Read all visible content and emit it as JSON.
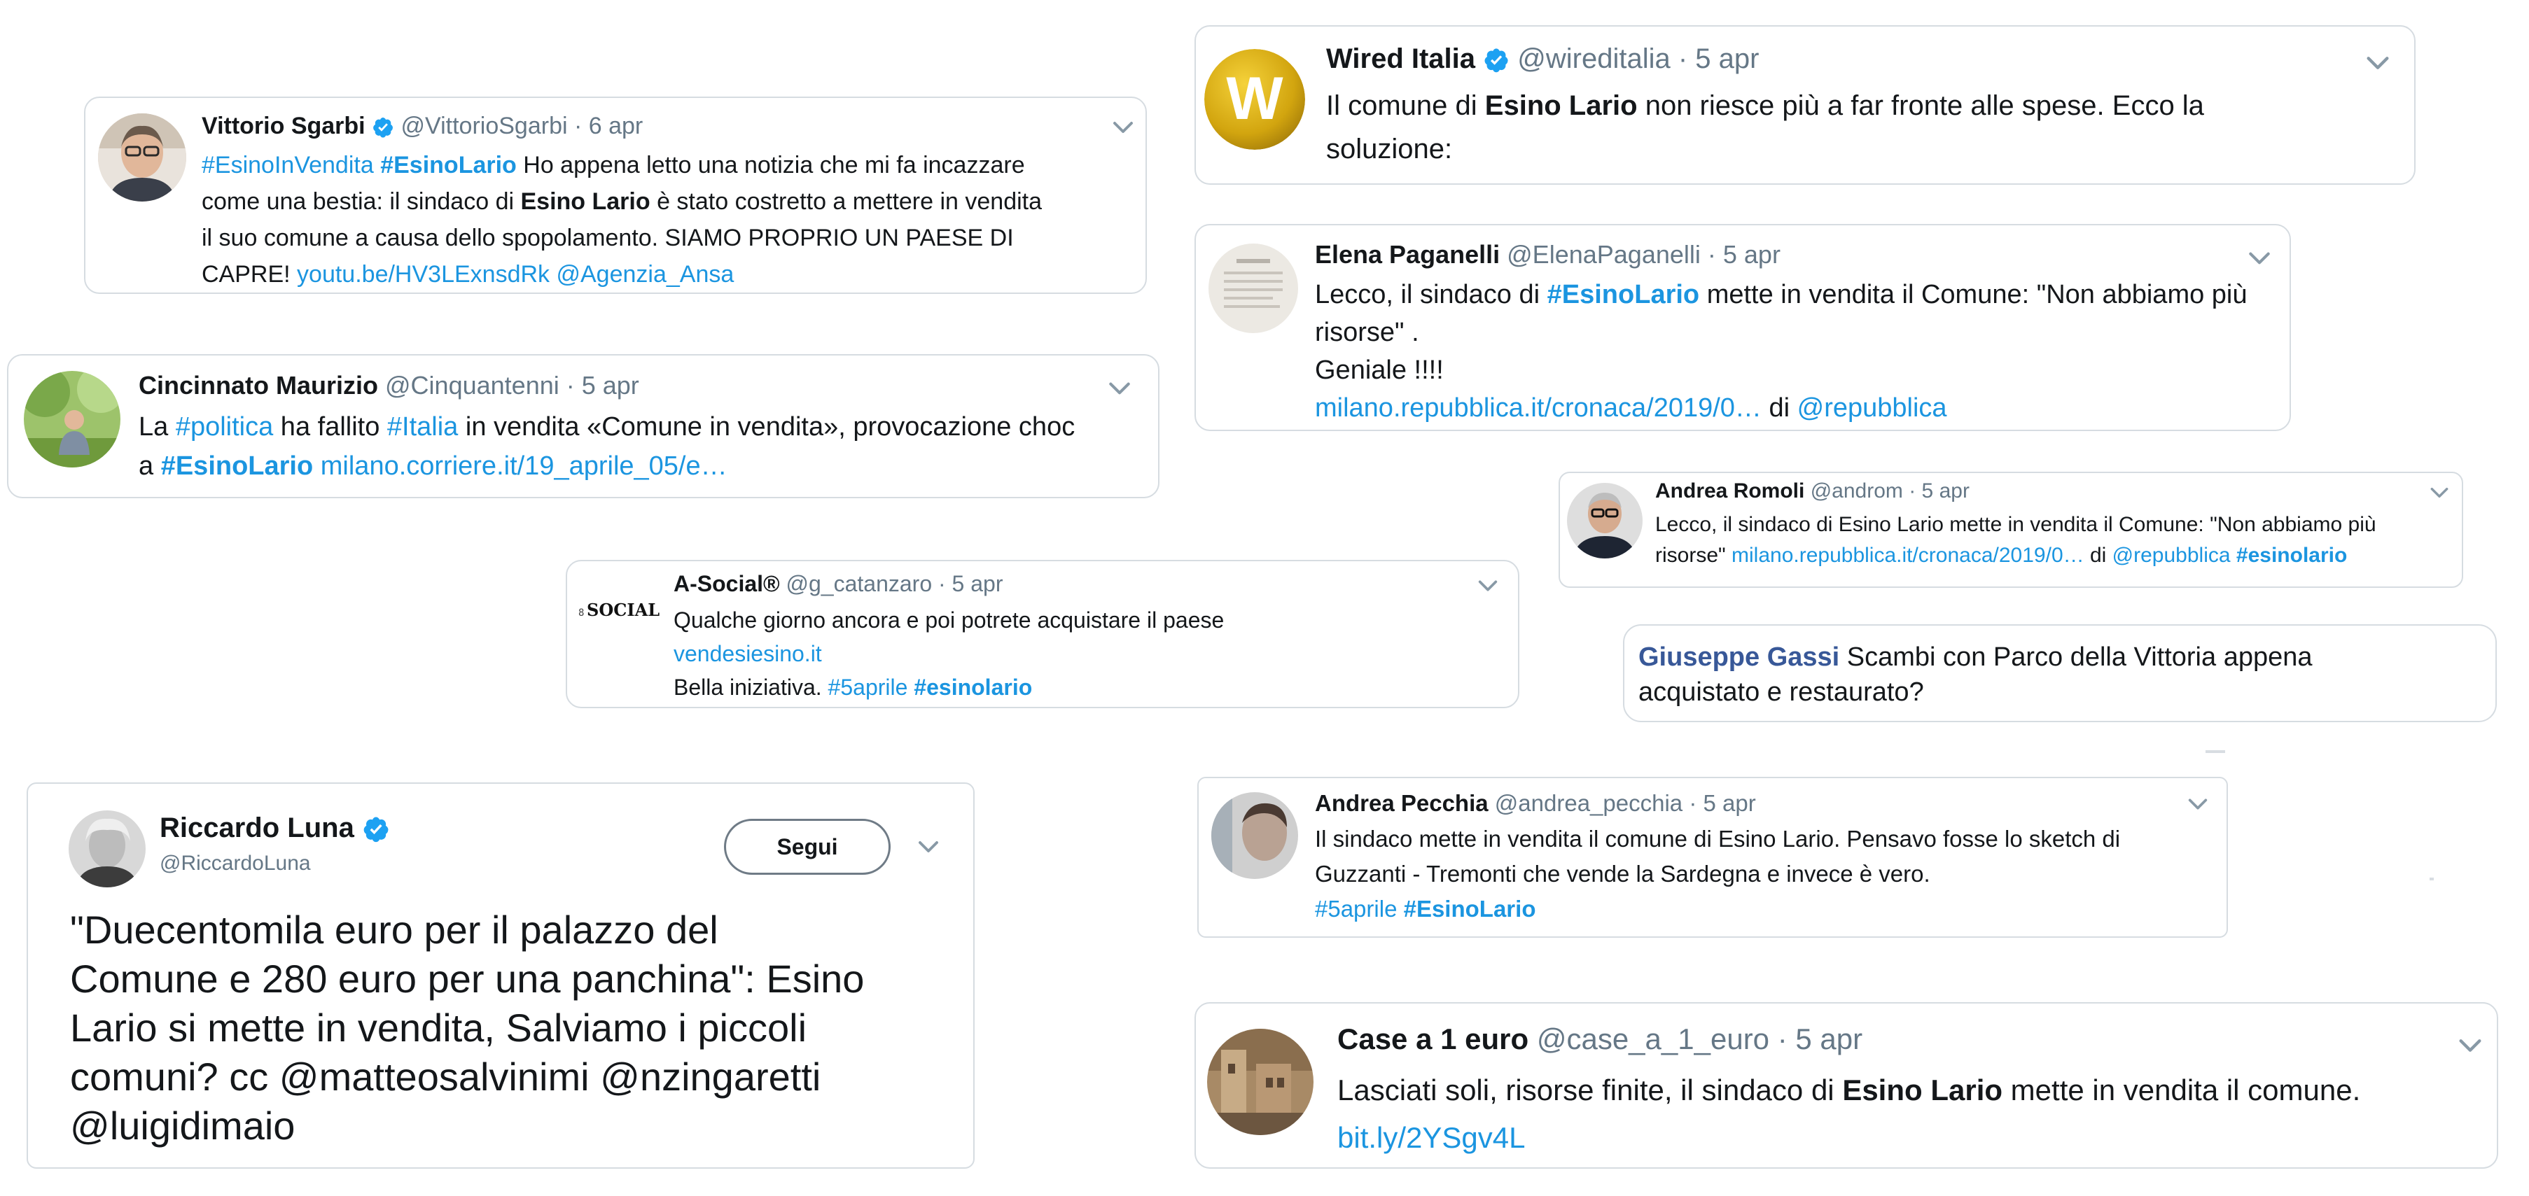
{
  "colors": {
    "link": "#1b95e0",
    "text": "#14171a",
    "muted": "#657786",
    "border": "#d6dce1"
  },
  "tweets": {
    "sgarbi": {
      "name": "Vittorio Sgarbi",
      "handle": "@VittorioSgarbi",
      "date": "· 6 apr",
      "l1_t1": "#EsinoInVendita",
      "l1_t2": "#EsinoLario",
      "l1_s": " Ho appena letto una notizia che mi fa incazzare",
      "l2_s1": "come una bestia: il sindaco di ",
      "l2_b": "Esino Lario",
      "l2_s2": " è stato costretto a mettere in  vendita",
      "l3": "il suo comune a causa dello spopolamento. SIAMO PROPRIO UN PAESE DI",
      "l4_s": "CAPRE! ",
      "l4_link": "youtu.be/HV3LExnsdRk",
      "l4_mention": "@Agenzia_Ansa",
      "avatar_icon": "person-avatar-icon"
    },
    "cincinnato": {
      "name": "Cincinnato Maurizio",
      "handle": "@Cinquantenni",
      "date": "· 5 apr",
      "l1_s1": "La ",
      "l1_t1": "#politica",
      "l1_s2": " ha fallito ",
      "l1_t2": "#Italia",
      "l1_s3": " in vendita «Comune in vendita», provocazione choc",
      "l2_s": "a ",
      "l2_t": "#EsinoLario",
      "l2_link": "milano.corriere.it/19_aprile_05/e…"
    },
    "asocial": {
      "name": "A-Social®",
      "handle": "@g_catanzaro",
      "date": "· 5 apr",
      "logo": "SOCIAL",
      "l1": "Qualche giorno ancora e poi potrete acquistare il paese",
      "l2_link": "vendesiesino.it",
      "l3_s": "Bella iniziativa. ",
      "l3_t1": "#5aprile",
      "l3_t2": "#esinolario"
    },
    "luna": {
      "name": "Riccardo Luna",
      "handle": "@RiccardoLuna",
      "follow": "Segui",
      "l1": "\"Duecentomila euro per il palazzo del",
      "l2": "Comune e 280 euro per una panchina\": Esino",
      "l3": "Lario si mette in vendita, Salviamo i piccoli",
      "l4": "comuni? cc @matteosalvinimi @nzingaretti",
      "l5": "@luigidimaio"
    },
    "wired": {
      "name": "Wired Italia",
      "handle": "@wireditalia",
      "date": "· 5 apr",
      "logo_letter": "W",
      "l1_s1": "Il comune di ",
      "l1_b": "Esino Lario",
      "l1_s2": " non riesce più a far fronte alle spese. Ecco la",
      "l2": "soluzione:"
    },
    "paganelli": {
      "name": "Elena Paganelli",
      "handle": "@ElenaPaganelli",
      "date": "· 5 apr",
      "l1_s1": "Lecco, il sindaco di ",
      "l1_t": "#EsinoLario",
      "l1_s2": " mette in vendita il Comune: \"Non abbiamo più",
      "l2": "risorse\" .",
      "l3": "Geniale !!!!",
      "l4_link": "milano.repubblica.it/cronaca/2019/0…",
      "l4_s": " di ",
      "l4_mention": "@repubblica"
    },
    "romoli": {
      "name": "Andrea Romoli",
      "handle": "@androm",
      "date": "· 5 apr",
      "l1": "Lecco, il sindaco di Esino Lario mette in vendita il Comune: \"Non abbiamo più",
      "l2_s1": "risorse\" ",
      "l2_link": "milano.repubblica.it/cronaca/2019/0…",
      "l2_s2": " di ",
      "l2_mention": "@repubblica",
      "l2_t": "#esinolario"
    },
    "gassi": {
      "name": "Giuseppe Gassi",
      "l1_s": " Scambi con Parco della Vittoria appena",
      "l2": "acquistato e restaurato?"
    },
    "pecchia": {
      "name": "Andrea Pecchia",
      "handle": "@andrea_pecchia",
      "date": "· 5 apr",
      "l1": "Il sindaco mette in vendita il comune di Esino Lario. Pensavo fosse lo sketch di",
      "l2": "Guzzanti - Tremonti che vende la Sardegna e invece è vero.",
      "l3_t1": "#5aprile",
      "l3_t2": "#EsinoLario"
    },
    "case": {
      "name": "Case a 1 euro",
      "handle": "@case_a_1_euro",
      "date": "· 5 apr",
      "l1_s1": "Lasciati soli, risorse finite, il sindaco di ",
      "l1_b": "Esino Lario",
      "l1_s2": " mette in vendita il comune.",
      "l2_link": "bit.ly/2YSgv4L"
    }
  }
}
